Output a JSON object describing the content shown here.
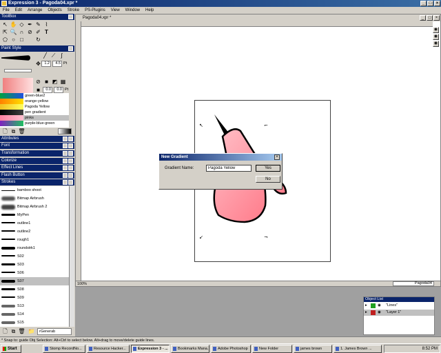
{
  "window": {
    "title": "Expression 3 - Pagoda04.xpr *"
  },
  "menu": [
    "File",
    "Edit",
    "Arrange",
    "Objects",
    "Stroke",
    "PS-Plugins",
    "View",
    "Window",
    "Help"
  ],
  "panels": {
    "toolbox": "ToolBox",
    "paint_style": "Paint Style",
    "attributes": "Attributes",
    "font": "Font",
    "transformation": "Transformation",
    "colorize": "Colorize",
    "effect_lines": "Effect Lines",
    "flash_button": "Flash Button",
    "strokes": "Strokes"
  },
  "paint_style": {
    "width_value": "1.2",
    "width_value2": "4.5",
    "unit": "Pt",
    "opacity_value": "0.0",
    "unit2": "Pt",
    "gradients": [
      {
        "name": "green-blue2",
        "c1": "#00a040",
        "c2": "#2050e0"
      },
      {
        "name": "orange-yellow",
        "c1": "#ff8000",
        "c2": "#ffe000"
      },
      {
        "name": "Pagoda Yellow",
        "c1": "#f0c020",
        "c2": "#ffff60"
      },
      {
        "name": "pen gradient",
        "c1": "#000000",
        "c2": "#404040"
      },
      {
        "name": "pinks",
        "c1": "#ff80a0",
        "c2": "#ffc0d0"
      },
      {
        "name": "purple-blue-green",
        "c1": "#8020c0",
        "c2": "#20c060"
      }
    ]
  },
  "strokes": [
    "bamboo shoot",
    "Bitmap Airbrush",
    "Bitmap Airbrush 2",
    "MyPen",
    "outline1",
    "outline2",
    "rough1",
    "roundstrk1",
    "S02",
    "S03",
    "S06",
    "S07",
    "S08",
    "S09",
    "S13",
    "S14",
    "S15"
  ],
  "strokes_dropdown": "rGenerab",
  "document": {
    "title": "Pagoda04.xpr *",
    "zoom": "100%"
  },
  "dialog": {
    "title": "New Gradient",
    "label": "Gradient Name:",
    "value": "Pagoda Yellow",
    "yes": "Yes",
    "no": "No"
  },
  "object_list": {
    "title": "Object List",
    "rows": [
      {
        "name": "\"Lines\"",
        "color": "#20a020"
      },
      {
        "name": "\"Layer 1\"",
        "color": "#c02020"
      }
    ]
  },
  "status": "* Snap to: guide   Obj Selection: Alt+Ctrl to select below. Alt+drag to move/delete guide lines.",
  "page_label": "Pagoda04",
  "taskbar": {
    "start": "Start",
    "items": [
      "Stomp RecordNo...",
      "Resource Hacker...",
      "Expression 3 - ...",
      "Bookmarks Mana...",
      "Adobe Photoshop",
      "New Folder",
      "james brown",
      "1. James Brown ..."
    ],
    "clock": "8:52 PM"
  }
}
